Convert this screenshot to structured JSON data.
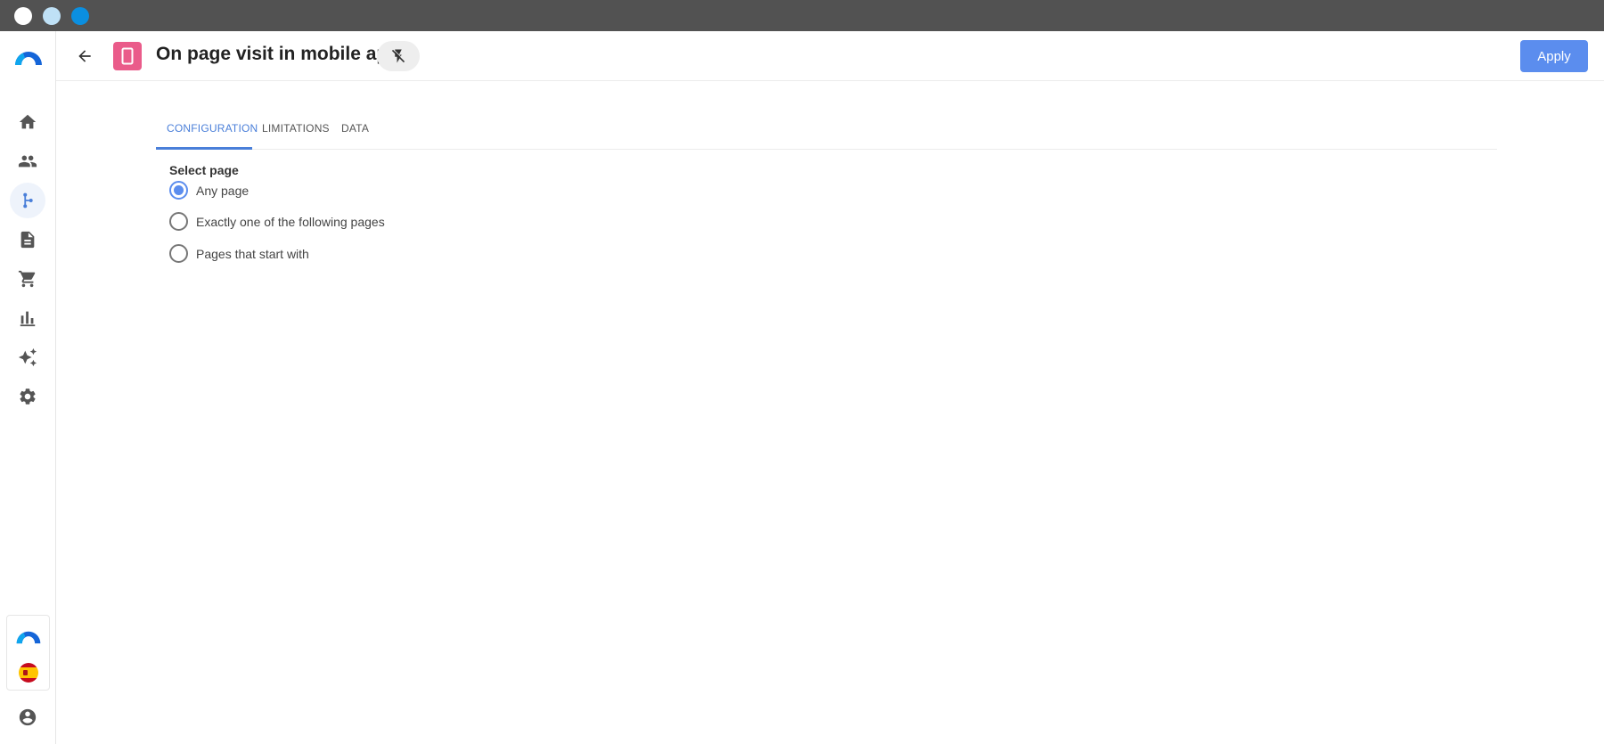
{
  "window": {
    "controls": [
      "close",
      "minimize",
      "maximize"
    ]
  },
  "sidebar": {
    "logo_icon": "brand-logo-icon",
    "items": [
      {
        "icon": "home-icon",
        "active": false
      },
      {
        "icon": "people-icon",
        "active": false
      },
      {
        "icon": "workflow-branch-icon",
        "active": true
      },
      {
        "icon": "document-icon",
        "active": false
      },
      {
        "icon": "cart-icon",
        "active": false
      },
      {
        "icon": "bar-chart-icon",
        "active": false
      },
      {
        "icon": "sparkles-icon",
        "active": false
      },
      {
        "icon": "gear-icon",
        "active": false
      }
    ],
    "bottom": [
      "brand-logo-icon",
      "spain-flag-icon",
      "account-icon"
    ]
  },
  "header": {
    "title": "On page visit in mobile app",
    "badge_icon": "mobile-phone-icon",
    "badge_color": "#ea5b8a",
    "flash_icon": "flash-off-icon",
    "apply_label": "Apply"
  },
  "tabs": [
    {
      "label": "CONFIGURATION",
      "active": true
    },
    {
      "label": "LIMITATIONS",
      "active": false
    },
    {
      "label": "DATA",
      "active": false
    }
  ],
  "form": {
    "label": "Select page",
    "options": [
      {
        "label": "Any page",
        "checked": true
      },
      {
        "label": "Exactly one of the following pages",
        "checked": false
      },
      {
        "label": "Pages that start with",
        "checked": false
      }
    ]
  },
  "colors": {
    "accent": "#5b8dee",
    "titlebar": "#525252"
  }
}
